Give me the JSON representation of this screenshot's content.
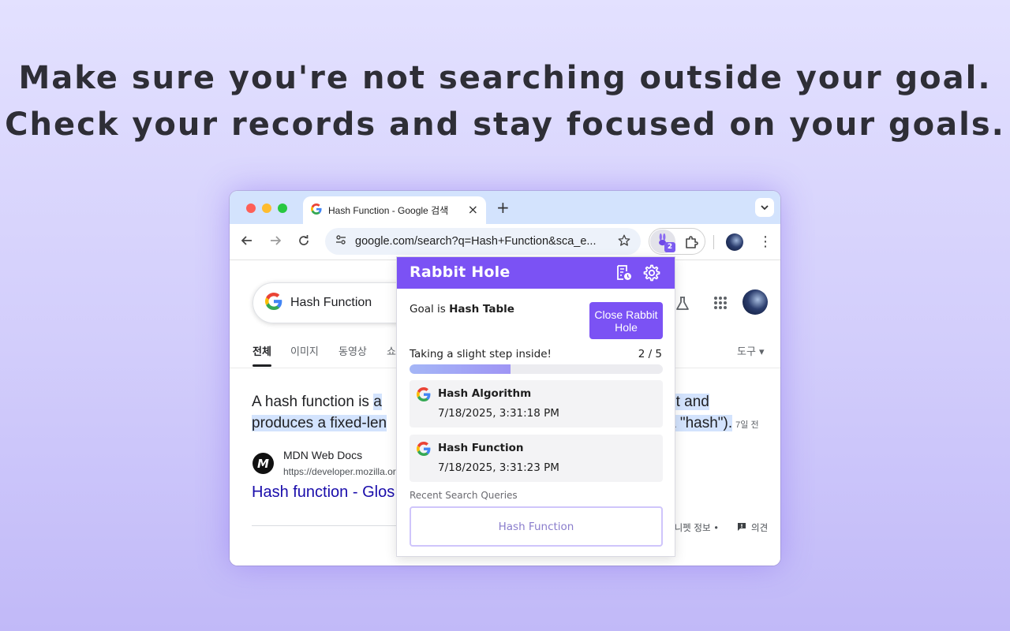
{
  "headline": {
    "line1": "Make sure you're not searching outside your goal.",
    "line2": "Check your records and stay focused on your goals."
  },
  "browser": {
    "tab_title": "Hash Function - Google 검색",
    "tab_close": "×",
    "new_tab": "+",
    "url": "google.com/search?q=Hash+Function&sca_e...",
    "extension_badge": "2",
    "menu": "⋮"
  },
  "google": {
    "query": "Hash Function",
    "tabs": [
      "전체",
      "이미지",
      "동영상",
      "쇼"
    ],
    "tools": "도구 ▾",
    "snippet_start": "A hash function is ",
    "snippet_highlight": "a ",
    "snippet_end_line1": "ut and",
    "snippet_line2_start": "produces a fixed-len",
    "snippet_line2_end": "a \"hash\").",
    "snippet_date": "7일 전",
    "source_icon": "M",
    "source_name": "MDN Web Docs",
    "source_url": "https://developer.mozilla.or",
    "result_link": "Hash function - Glos",
    "footer_info": "스니펫 정보  •",
    "footer_feedback": "의견"
  },
  "popup": {
    "title": "Rabbit Hole",
    "goal_prefix": "Goal is ",
    "goal_value": "Hash Table",
    "close_button": "Close Rabbit Hole",
    "status_text": "Taking a slight step inside!",
    "step_count": "2 / 5",
    "progress": 0.4,
    "history": [
      {
        "title": "Hash Algorithm",
        "time": "7/18/2025, 3:31:18 PM"
      },
      {
        "title": "Hash Function",
        "time": "7/18/2025, 3:31:23 PM"
      }
    ],
    "recent_label": "Recent Search Queries",
    "recent_query": "Hash Function"
  },
  "colors": {
    "accent": "#7b52f4",
    "google_blue": "#4285F4",
    "google_red": "#EA4335",
    "google_yellow": "#FBBC05",
    "google_green": "#34A853"
  }
}
